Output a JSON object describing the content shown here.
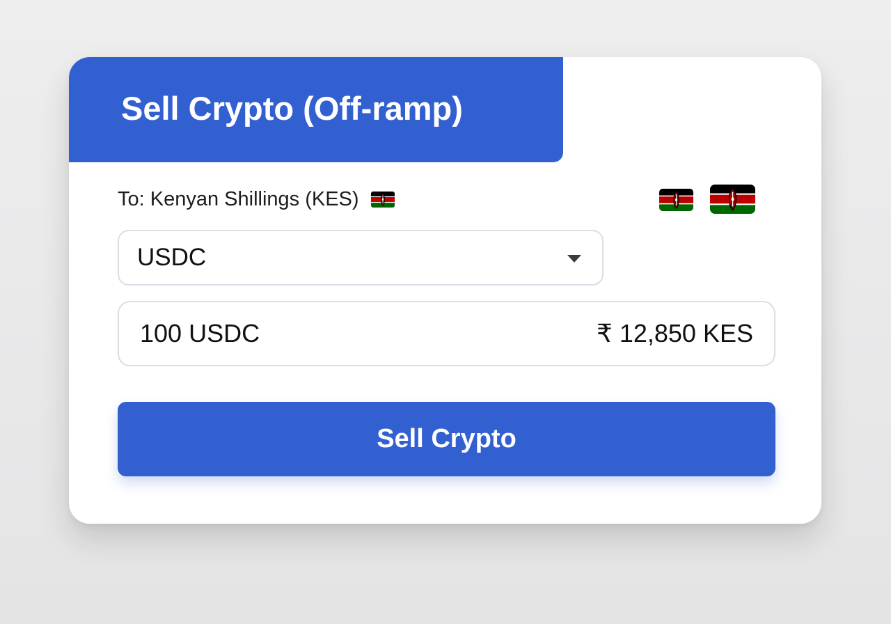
{
  "header": {
    "title": "Sell Crypto (Off-ramp)",
    "color": "#3360d1"
  },
  "destination": {
    "label": "To: Kenyan Shillings (KES)",
    "flag_icon": "kenya-flag-icon"
  },
  "currency_select": {
    "selected": "USDC",
    "icon": "chevron-down-icon"
  },
  "amount": {
    "value": "100 USDC",
    "converted": "₹ 12,850 KES"
  },
  "actions": {
    "sell_label": "Sell Crypto",
    "color": "#3360d1"
  },
  "flags": [
    {
      "icon": "kenya-flag-icon",
      "colors": [
        "#000000",
        "#bb0000",
        "#006600",
        "#ffffff"
      ]
    }
  ]
}
